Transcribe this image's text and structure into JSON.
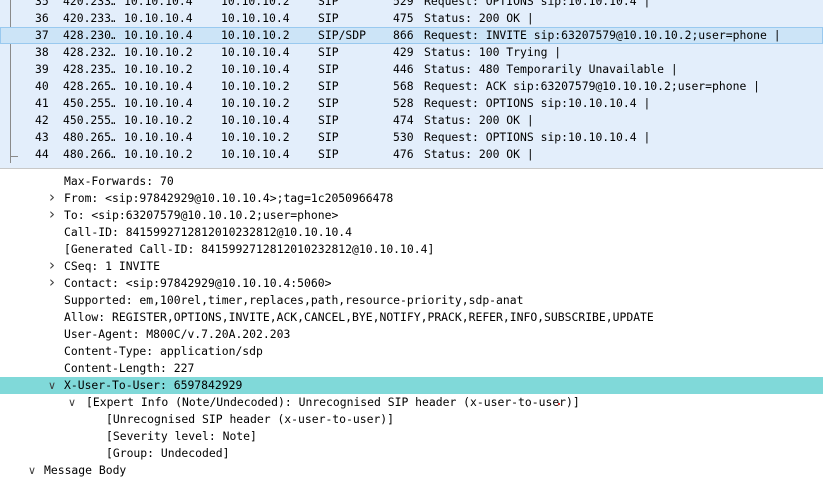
{
  "packet_list": {
    "rows": [
      {
        "no": "35",
        "time": "420.233…",
        "src": "10.10.10.4",
        "dst": "10.10.10.2",
        "proto": "SIP",
        "len": "529",
        "info": "Request: OPTIONS sip:10.10.10.4 |",
        "selected": false
      },
      {
        "no": "36",
        "time": "420.233…",
        "src": "10.10.10.4",
        "dst": "10.10.10.4",
        "proto": "SIP",
        "len": "475",
        "info": "Status: 200 OK |",
        "selected": false
      },
      {
        "no": "37",
        "time": "428.230…",
        "src": "10.10.10.4",
        "dst": "10.10.10.2",
        "proto": "SIP/SDP",
        "len": "866",
        "info": "Request: INVITE sip:63207579@10.10.10.2;user=phone |",
        "selected": true
      },
      {
        "no": "38",
        "time": "428.232…",
        "src": "10.10.10.2",
        "dst": "10.10.10.4",
        "proto": "SIP",
        "len": "429",
        "info": "Status: 100 Trying |",
        "selected": false
      },
      {
        "no": "39",
        "time": "428.235…",
        "src": "10.10.10.2",
        "dst": "10.10.10.4",
        "proto": "SIP",
        "len": "446",
        "info": "Status: 480 Temporarily Unavailable |",
        "selected": false
      },
      {
        "no": "40",
        "time": "428.265…",
        "src": "10.10.10.4",
        "dst": "10.10.10.2",
        "proto": "SIP",
        "len": "568",
        "info": "Request: ACK sip:63207579@10.10.10.2;user=phone |",
        "selected": false
      },
      {
        "no": "41",
        "time": "450.255…",
        "src": "10.10.10.4",
        "dst": "10.10.10.2",
        "proto": "SIP",
        "len": "528",
        "info": "Request: OPTIONS sip:10.10.10.4 |",
        "selected": false
      },
      {
        "no": "42",
        "time": "450.255…",
        "src": "10.10.10.2",
        "dst": "10.10.10.4",
        "proto": "SIP",
        "len": "474",
        "info": "Status: 200 OK |",
        "selected": false
      },
      {
        "no": "43",
        "time": "480.265…",
        "src": "10.10.10.4",
        "dst": "10.10.10.2",
        "proto": "SIP",
        "len": "530",
        "info": "Request: OPTIONS sip:10.10.10.4 |",
        "selected": false
      },
      {
        "no": "44",
        "time": "480.266…",
        "src": "10.10.10.2",
        "dst": "10.10.10.4",
        "proto": "SIP",
        "len": "476",
        "info": "Status: 200 OK |",
        "selected": false
      }
    ]
  },
  "detail_tree": {
    "rows": [
      {
        "indent": 0,
        "arrow": "",
        "label": "Max-Forwards: 70",
        "highlight": false
      },
      {
        "indent": 0,
        "arrow": ">",
        "label": "From: <sip:97842929@10.10.10.4>;tag=1c2050966478",
        "highlight": false
      },
      {
        "indent": 0,
        "arrow": ">",
        "label": "To: <sip:63207579@10.10.10.2;user=phone>",
        "highlight": false
      },
      {
        "indent": 0,
        "arrow": "",
        "label": "Call-ID: 8415992712812010232812@10.10.10.4",
        "highlight": false
      },
      {
        "indent": 0,
        "arrow": "",
        "label": "[Generated Call-ID: 8415992712812010232812@10.10.10.4]",
        "highlight": false
      },
      {
        "indent": 0,
        "arrow": ">",
        "label": "CSeq: 1 INVITE",
        "highlight": false
      },
      {
        "indent": 0,
        "arrow": ">",
        "label": "Contact: <sip:97842929@10.10.10.4:5060>",
        "highlight": false
      },
      {
        "indent": 0,
        "arrow": "",
        "label": "Supported: em,100rel,timer,replaces,path,resource-priority,sdp-anat",
        "highlight": false
      },
      {
        "indent": 0,
        "arrow": "",
        "label": "Allow: REGISTER,OPTIONS,INVITE,ACK,CANCEL,BYE,NOTIFY,PRACK,REFER,INFO,SUBSCRIBE,UPDATE",
        "highlight": false
      },
      {
        "indent": 0,
        "arrow": "",
        "label": "User-Agent: M800C/v.7.20A.202.203",
        "highlight": false
      },
      {
        "indent": 0,
        "arrow": "",
        "label": "Content-Type: application/sdp",
        "highlight": false
      },
      {
        "indent": 0,
        "arrow": "",
        "label": "Content-Length: 227",
        "highlight": false
      },
      {
        "indent": 0,
        "arrow": "v",
        "label": "X-User-To-User: 6597842929",
        "highlight": true
      },
      {
        "indent": 1,
        "arrow": "v",
        "label": "[Expert Info (Note/Undecoded): Unrecognised SIP header (x-user-to-user)]",
        "highlight": false
      },
      {
        "indent": 2,
        "arrow": "",
        "label": "[Unrecognised SIP header (x-user-to-user)]",
        "highlight": false
      },
      {
        "indent": 2,
        "arrow": "",
        "label": "[Severity level: Note]",
        "highlight": false
      },
      {
        "indent": 2,
        "arrow": "",
        "label": "[Group: Undecoded]",
        "highlight": false
      },
      {
        "indent": -1,
        "arrow": "v",
        "label": "Message Body",
        "highlight": false
      }
    ]
  }
}
